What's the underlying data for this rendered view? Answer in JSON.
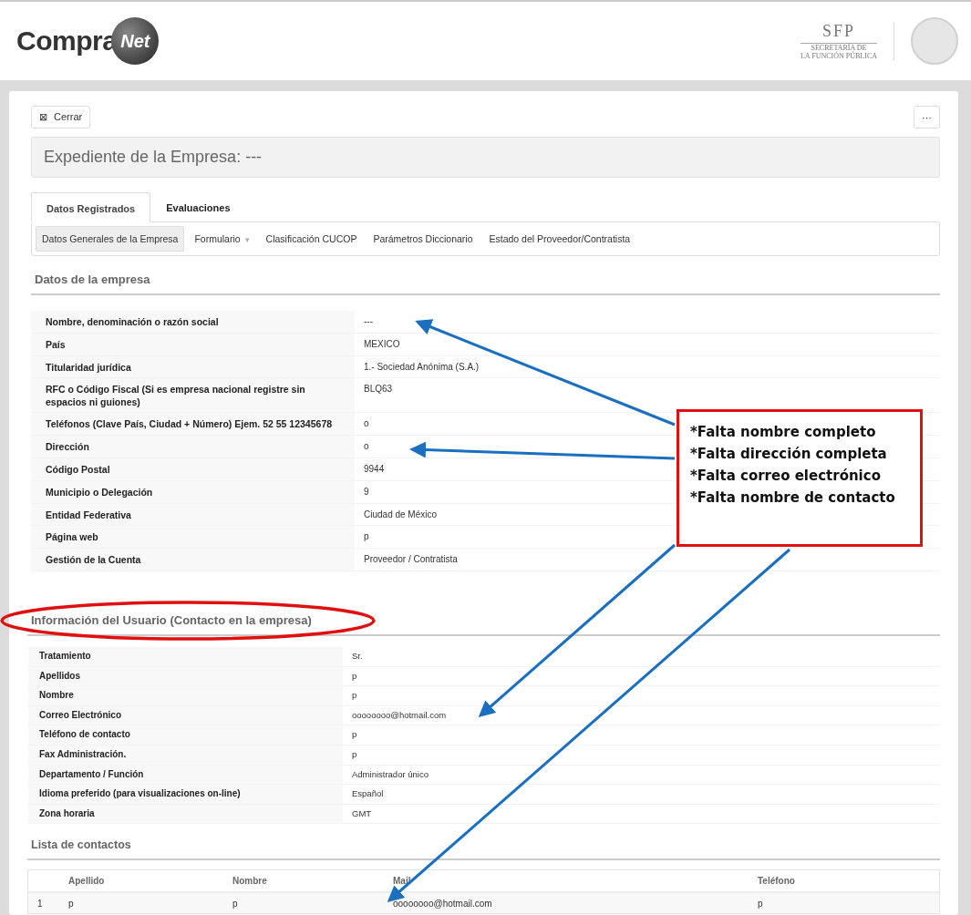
{
  "header": {
    "logo_text": "Compra",
    "logo_globe_text": "Net",
    "agency": {
      "acronym": "SFP",
      "line_1": "SECRETARÍA DE",
      "line_2": "LA FUNCIÓN PÚBLICA"
    }
  },
  "toolbar": {
    "close_icon": "⊠",
    "close_label": "Cerrar",
    "more_label": "···"
  },
  "title": "Expediente de la Empresa: ---",
  "tabs": [
    {
      "label": "Datos Registrados",
      "selected": true
    },
    {
      "label": "Evaluaciones",
      "selected": false
    }
  ],
  "subnav": [
    {
      "label": "Datos Generales de la Empresa",
      "selected": true
    },
    {
      "label": "Formulario",
      "selected": false,
      "caret": "▾"
    },
    {
      "label": "Clasificación CUCOP",
      "selected": false
    },
    {
      "label": "Parámetros Diccionario",
      "selected": false
    },
    {
      "label": "Estado del Proveedor/Contratista",
      "selected": false
    }
  ],
  "company": {
    "heading": "Datos de la empresa",
    "rows": [
      {
        "label": "Nombre, denominación o razón social",
        "value": "---"
      },
      {
        "label": "País",
        "value": "MEXICO"
      },
      {
        "label": "Titularidad jurídica",
        "value": "1.- Sociedad Anónima (S.A.)"
      },
      {
        "label": "RFC o Código Fiscal (Si es empresa nacional registre sin espacios ni guiones)",
        "value": "BLQ63"
      },
      {
        "label": "Teléfonos (Clave País, Ciudad + Número) Ejem. 52 55 12345678",
        "value": "o"
      },
      {
        "label": "Dirección",
        "value": "o"
      },
      {
        "label": "Código Postal",
        "value": "9944"
      },
      {
        "label": "Municipio o Delegación",
        "value": "9"
      },
      {
        "label": "Entidad Federativa",
        "value": "Ciudad de México"
      },
      {
        "label": "Página web",
        "value": "p"
      },
      {
        "label": "Gestión de la Cuenta",
        "value": "Proveedor / Contratista"
      }
    ]
  },
  "user": {
    "heading": "Información del Usuario (Contacto en la empresa)",
    "rows": [
      {
        "label": "Tratamiento",
        "value": "Sr."
      },
      {
        "label": "Apellidos",
        "value": "p"
      },
      {
        "label": "Nombre",
        "value": "p"
      },
      {
        "label": "Correo Electrónico",
        "value": "oooooooo@hotmail.com"
      },
      {
        "label": "Teléfono de contacto",
        "value": "p"
      },
      {
        "label": "Fax Administración.",
        "value": "p"
      },
      {
        "label": "Departamento / Función",
        "value": "Administrador único"
      },
      {
        "label": "Idioma preferido (para visualizaciones on-line)",
        "value": "Español"
      },
      {
        "label": "Zona horaria",
        "value": "GMT"
      }
    ]
  },
  "contacts": {
    "heading": "Lista de contactos",
    "columns": [
      "Apellido",
      "Nombre",
      "Mail",
      "Teléfono"
    ],
    "rows": [
      {
        "index": "1",
        "cells": [
          "p",
          "p",
          "oooooooo@hotmail.com",
          "p"
        ]
      }
    ]
  },
  "annotation": {
    "notes": [
      "*Falta nombre completo",
      "*Falta dirección completa",
      "*Falta correo electrónico",
      "*Falta nombre de contacto"
    ]
  }
}
